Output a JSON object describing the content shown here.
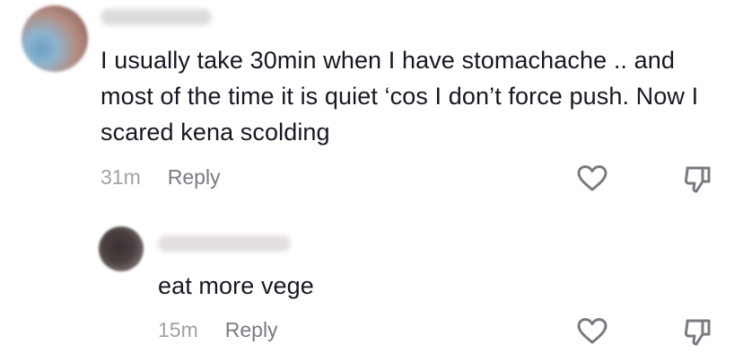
{
  "comments": [
    {
      "username": "",
      "text": "I usually take 30min when I have stomachache .. and most of the time it is quiet ‘cos I don’t force push. Now I scared kena scolding",
      "time": "31m",
      "reply_label": "Reply",
      "like_icon": "heart-outline-icon",
      "dislike_icon": "thumbs-down-icon"
    },
    {
      "username": "",
      "text": "eat more vege",
      "time": "15m",
      "reply_label": "Reply",
      "like_icon": "heart-outline-icon",
      "dislike_icon": "thumbs-down-icon"
    }
  ],
  "colors": {
    "text": "#161823",
    "meta_time": "#a1a2a7",
    "meta_reply": "#7a7b82",
    "icon_stroke": "#7a7b82"
  }
}
